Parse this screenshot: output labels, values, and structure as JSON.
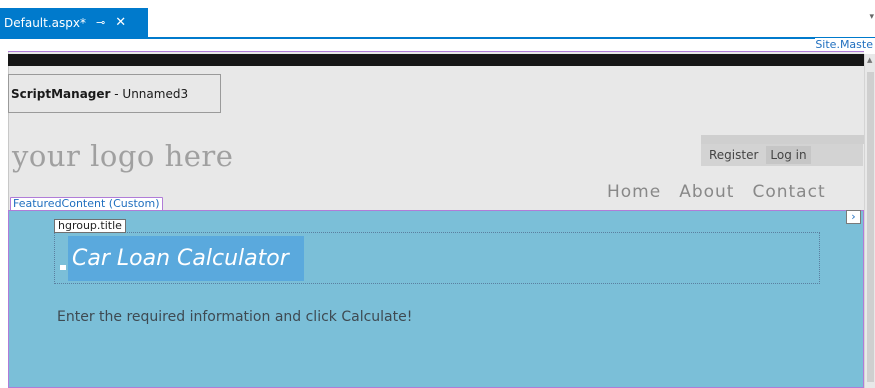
{
  "tab": {
    "title": "Default.aspx*",
    "pin_icon": "pin-icon",
    "close_icon": "close-icon"
  },
  "master_label": "Site.Maste",
  "script_manager": {
    "name": "ScriptManager",
    "separator": " - ",
    "id": "Unnamed3"
  },
  "logo_text": "your logo here",
  "login": {
    "register": "Register",
    "login": "Log in"
  },
  "menu": {
    "items": [
      "Home",
      "About",
      "Contact"
    ]
  },
  "featured": {
    "tag": "FeaturedContent (Custom)",
    "hgroup_tag": "hgroup.title",
    "page_title": "Car Loan Calculator",
    "instructions": "Enter the required information and click Calculate!"
  },
  "colors": {
    "accent": "#007acc",
    "featured_bg": "#7bbfd8",
    "selection": "#5aa9dd",
    "border_purple": "#b07cd8"
  }
}
